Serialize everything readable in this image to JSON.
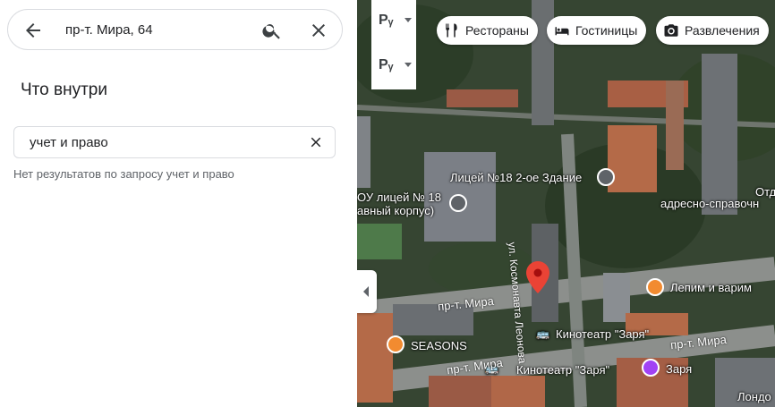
{
  "search": {
    "query": "пр-т. Мира, 64"
  },
  "inside": {
    "title": "Что внутри",
    "filter_value": "учет и право",
    "no_results": "Нет результатов по запросу учет и право"
  },
  "map": {
    "chips": [
      {
        "label": "Рестораны",
        "icon": "fork-knife-icon"
      },
      {
        "label": "Гостиницы",
        "icon": "bed-icon"
      },
      {
        "label": "Развлечения",
        "icon": "camera-icon"
      }
    ],
    "layer_symbol": "Pᵧ",
    "labels": {
      "licey2": "Лицей №18 2-ое Здание",
      "licey_main_1": "ОУ лицей № 18",
      "licey_main_2": "авный корпус)",
      "ot": "Отд",
      "adresno": "адресно-справочн",
      "lepim": "Лепим и варим",
      "seasons": "SEASONS",
      "kino1": "Кинотеатр \"Заря\"",
      "kino2": "Кинотеатр \"Заря\"",
      "zarya": "Заря",
      "london": "Лондо"
    },
    "streets": {
      "mira1": "пр-т. Мира",
      "mira2": "пр-т. Мира",
      "mira3": "пр-т. Мира",
      "kosmo": "ул. Космонавта Леонова"
    },
    "colors": {
      "poi_food": "#f28b30",
      "poi_cinema": "#a142f4",
      "pin": "#ea4335",
      "accent": "#1a73e8"
    }
  }
}
